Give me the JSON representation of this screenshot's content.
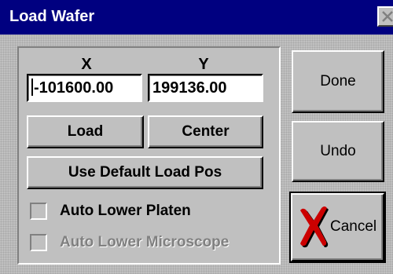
{
  "window": {
    "title": "Load Wafer",
    "close_icon": "close-icon"
  },
  "position": {
    "x_label": "X",
    "y_label": "Y",
    "x_value": "-101600.00",
    "y_value": "199136.00"
  },
  "buttons": {
    "load": "Load",
    "center": "Center",
    "use_default_load_pos": "Use Default Load Pos",
    "done": "Done",
    "undo": "Undo",
    "cancel": "Cancel",
    "cancel_icon": "red-x-icon"
  },
  "options": {
    "auto_lower_platen": {
      "label": "Auto Lower Platen",
      "checked": false,
      "enabled": true
    },
    "auto_lower_microscope": {
      "label": "Auto Lower Microscope",
      "checked": false,
      "enabled": false
    }
  },
  "colors": {
    "title_bar": "#000080",
    "face": "#c0c0c0",
    "cancel_icon": "#cc0000"
  }
}
